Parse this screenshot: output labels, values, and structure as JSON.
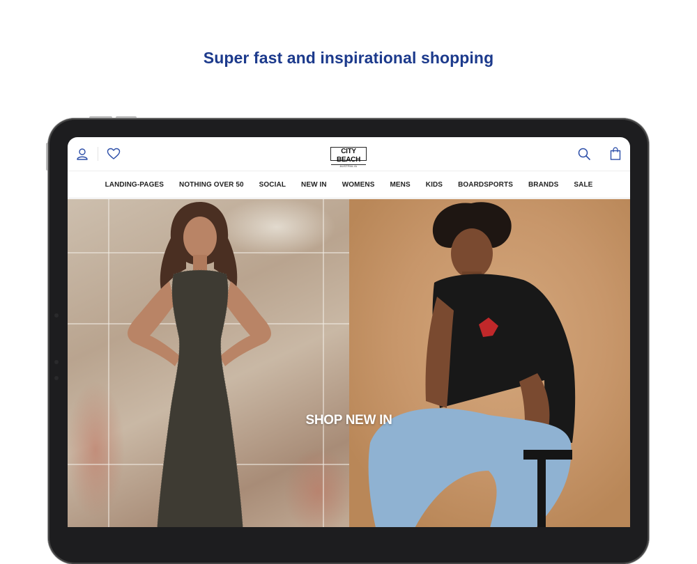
{
  "headline": "Super fast and inspirational shopping",
  "header": {
    "logo_text": "CITY BEACH",
    "logo_subtext": "AUSTRALIA",
    "icons": [
      "account-icon",
      "wishlist-heart-icon",
      "search-icon",
      "shopping-bag-icon"
    ]
  },
  "nav": {
    "items": [
      {
        "label": "LANDING-PAGES"
      },
      {
        "label": "NOTHING OVER 50"
      },
      {
        "label": "SOCIAL"
      },
      {
        "label": "NEW IN"
      },
      {
        "label": "WOMENS"
      },
      {
        "label": "MENS"
      },
      {
        "label": "KIDS"
      },
      {
        "label": "BOARDSPORTS"
      },
      {
        "label": "BRANDS"
      },
      {
        "label": "SALE"
      }
    ]
  },
  "hero": {
    "cta": "SHOP NEW IN"
  },
  "colors": {
    "headline": "#1c3a8c",
    "icon_blue": "#2c4ea8",
    "device_frame": "#1d1d1f"
  }
}
